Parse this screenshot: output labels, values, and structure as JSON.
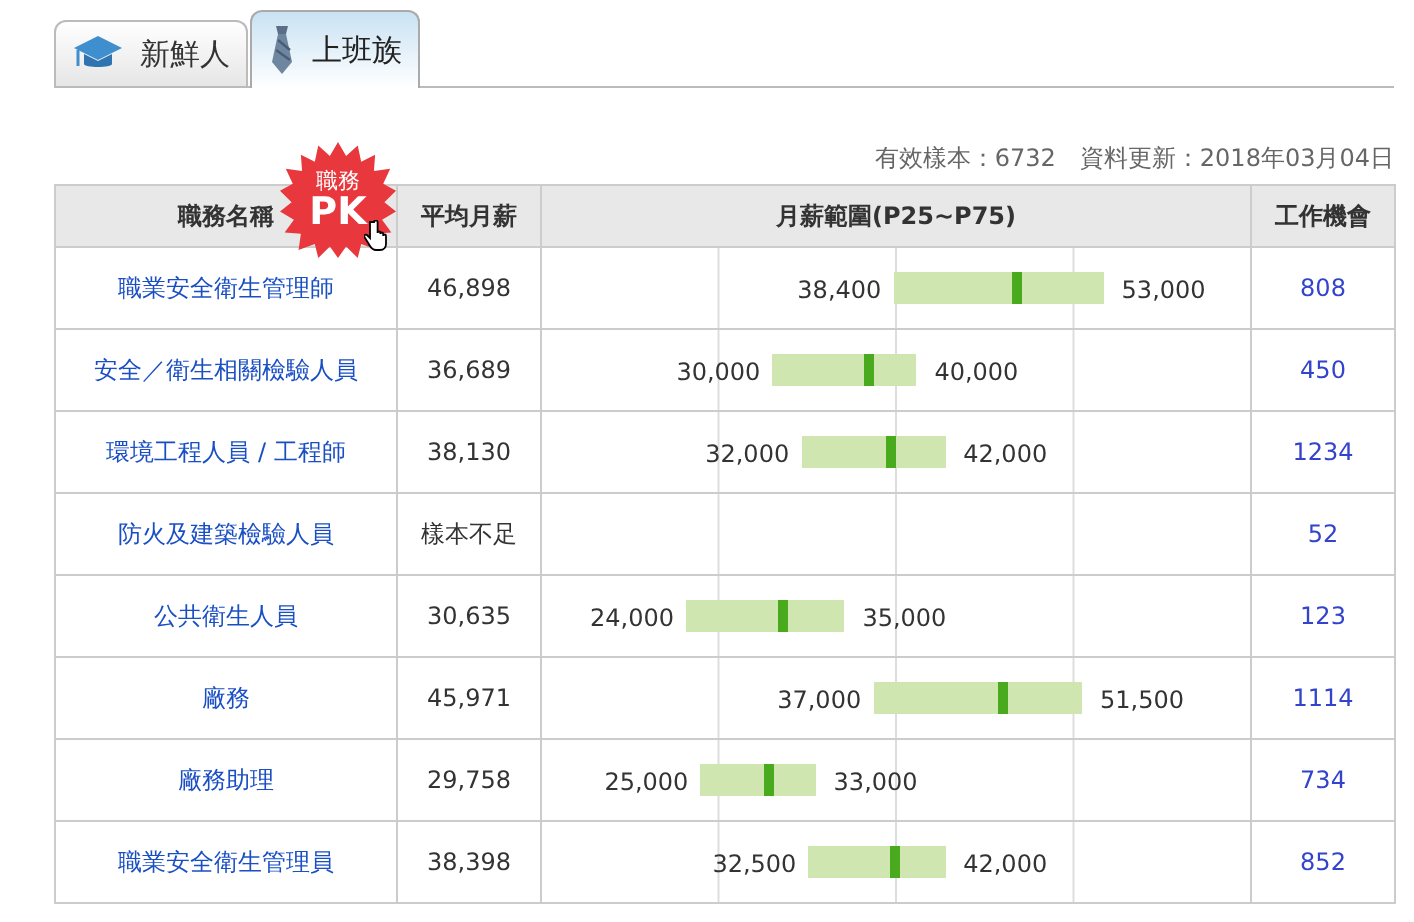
{
  "tabs": [
    {
      "label": "新鮮人",
      "selected": false
    },
    {
      "label": "上班族",
      "selected": true
    }
  ],
  "summary": "有效樣本：6732　資料更新：2018年03月04日",
  "pk_badge": {
    "line_1": "職務",
    "line_2": "PK"
  },
  "table": {
    "columns": [
      "職務名稱",
      "平均月薪",
      "月薪範圍(P25~P75)",
      "工作機會"
    ],
    "rows": [
      {
        "job": "職業安全衛生管理師",
        "average": "46,898",
        "low": "38,400",
        "high": "53,000",
        "openings": "808"
      },
      {
        "job": "安全／衛生相關檢驗人員",
        "average": "36,689",
        "low": "30,000",
        "high": "40,000",
        "openings": "450"
      },
      {
        "job": "環境工程人員 / 工程師",
        "average": "38,130",
        "low": "32,000",
        "high": "42,000",
        "openings": "1234"
      },
      {
        "job": "防火及建築檢驗人員",
        "average": "樣本不足",
        "openings": "52"
      },
      {
        "job": "公共衛生人員",
        "average": "30,635",
        "low": "24,000",
        "high": "35,000",
        "openings": "123"
      },
      {
        "job": "廠務",
        "average": "45,971",
        "low": "37,000",
        "high": "51,500",
        "openings": "1114"
      },
      {
        "job": "廠務助理",
        "average": "29,758",
        "low": "25,000",
        "high": "33,000",
        "openings": "734"
      },
      {
        "job": "職業安全衛生管理員",
        "average": "38,398",
        "low": "32,500",
        "high": "42,000",
        "openings": "852"
      }
    ]
  }
}
